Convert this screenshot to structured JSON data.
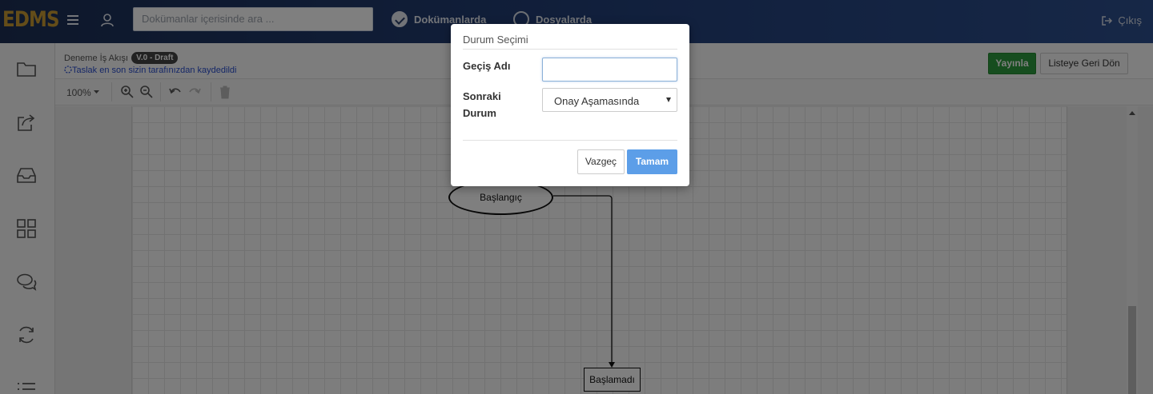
{
  "app": {
    "logo": "EDMS"
  },
  "header": {
    "search_placeholder": "Dokümanlar içerisinde ara ...",
    "radio_documents": "Dokümanlarda",
    "radio_files": "Dosyalarda",
    "logout": "Çıkış"
  },
  "workflow": {
    "title": "Deneme İş Akışı",
    "version": "V.0 - Draft",
    "draft_note": "Taslak en son sizin tarafınızdan kaydedildi",
    "publish_label": "Yayınla",
    "back_label": "Listeye Geri Dön"
  },
  "toolbar": {
    "zoom": "100%"
  },
  "diagram": {
    "start_node": "Başlangıç",
    "state_node": "Başlamadı"
  },
  "modal": {
    "title": "Durum Seçimi",
    "transition_label": "Geçiş Adı",
    "transition_value": "",
    "next_state_label_1": "Sonraki",
    "next_state_label_2": "Durum",
    "next_state_selected": "Onay Aşamasında",
    "cancel_label": "Vazgeç",
    "ok_label": "Tamam"
  },
  "colors": {
    "topbar": "#23407a",
    "logo": "#c99a32",
    "publish": "#2d9b3e",
    "ok_button": "#5c9ee8"
  }
}
